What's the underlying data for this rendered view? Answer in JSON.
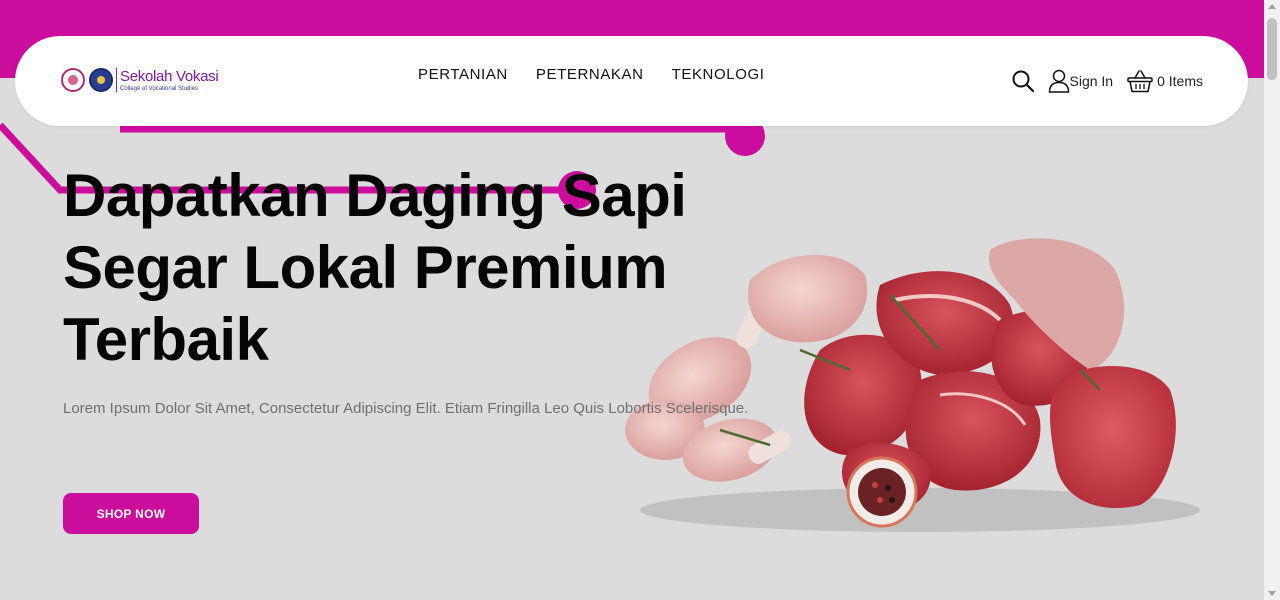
{
  "brand": {
    "name": "Sekolah Vokasi",
    "subtitle": "College of Vocational Studies"
  },
  "nav": {
    "items": [
      {
        "label": "PERTANIAN"
      },
      {
        "label": "PETERNAKAN"
      },
      {
        "label": "TEKNOLOGI"
      }
    ]
  },
  "actions": {
    "search_icon": "search-icon",
    "signin_label": "Sign In",
    "cart_label": "0 Items"
  },
  "hero": {
    "title_line1": "Dapatkan Daging Sapi",
    "title_line2": "Segar Lokal Premium",
    "title_line3": "Terbaik",
    "description": "Lorem Ipsum Dolor Sit Amet, Consectetur Adipiscing Elit. Etiam Fringilla Leo Quis Lobortis Scelerisque.",
    "cta_label": "SHOP NOW",
    "image_subject": "assorted raw meat: beef cuts, chicken drumsticks, minced meat, peppercorn bowl"
  },
  "colors": {
    "accent": "#cc0c9d",
    "background": "#dcdcdd",
    "header": "#ffffff",
    "heading_text": "#050505",
    "body_text": "#6f6f6f"
  }
}
